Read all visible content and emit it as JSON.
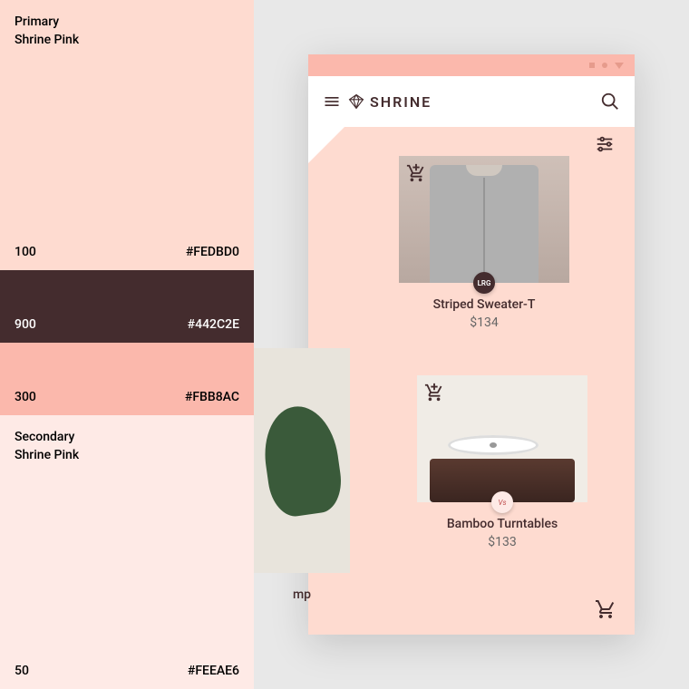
{
  "palette": {
    "primary": {
      "label": "Primary",
      "name": "Shrine Pink"
    },
    "secondary": {
      "label": "Secondary",
      "name": "Shrine Pink"
    },
    "sw100": {
      "level": "100",
      "hex": "#FEDBD0"
    },
    "sw900": {
      "level": "900",
      "hex": "#442C2E"
    },
    "sw300": {
      "level": "300",
      "hex": "#FBB8AC"
    },
    "sw50": {
      "level": "50",
      "hex": "#FEEAE6"
    }
  },
  "app": {
    "brand": "SHRINE",
    "products": {
      "p1": {
        "name": "Striped Sweater-T",
        "price": "$134",
        "badge": "LRG"
      },
      "p2": {
        "name": "mp",
        "price": ""
      },
      "p3": {
        "name": "Bamboo Turntables",
        "price": "$133",
        "badge": "Vs"
      }
    }
  }
}
